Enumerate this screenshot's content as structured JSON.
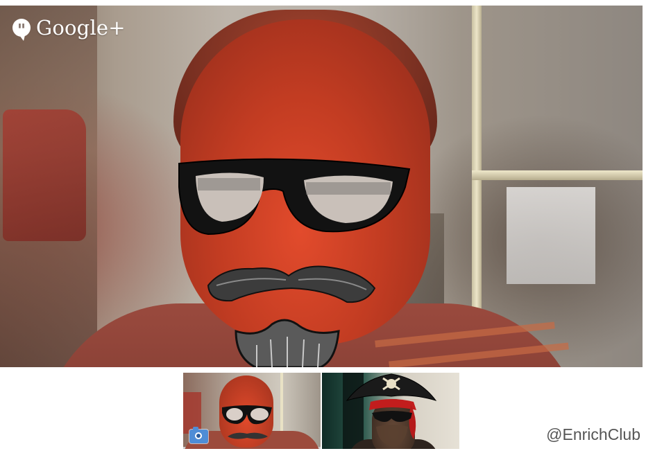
{
  "main_video": {
    "brand_name": "Google+",
    "hangouts_icon": "hangouts-quote-icon",
    "effects": [
      "glasses",
      "mustache",
      "beard"
    ]
  },
  "filmstrip": {
    "participants": [
      {
        "label": "self-view",
        "effect": "glasses-mustache",
        "selected": true
      },
      {
        "label": "participant-2",
        "effect": "pirate-hat"
      }
    ],
    "camera_icon": "camera-icon"
  },
  "watermark": {
    "text": "@EnrichClub"
  },
  "colors": {
    "camera_blue": "#4f8dd6",
    "skin_red": "#d8462a",
    "glasses_black": "#111111"
  }
}
